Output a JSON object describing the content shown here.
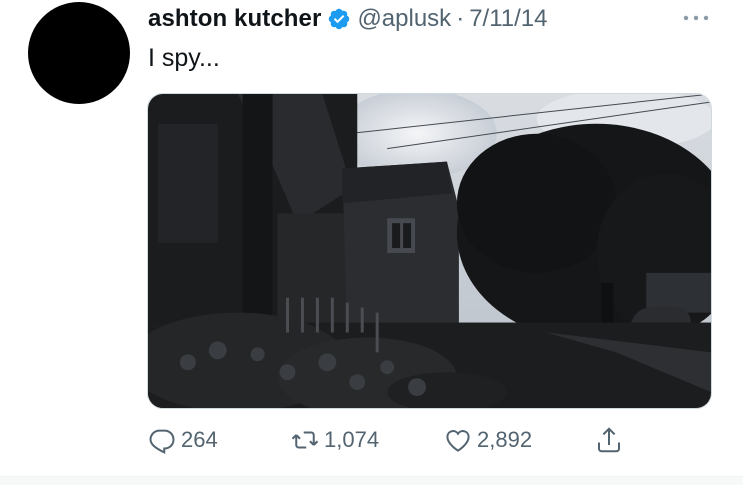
{
  "tweet": {
    "author_name": "ashton kutcher",
    "handle": "@aplusk",
    "separator": "·",
    "date": "7/11/14",
    "text": "I spy...",
    "verified": true
  },
  "actions": {
    "reply_count": "264",
    "retweet_count": "1,074",
    "like_count": "2,892"
  },
  "icons": {
    "avatar": "avatar",
    "verified": "verified-badge-icon",
    "more": "more-dots-icon",
    "reply": "reply-icon",
    "retweet": "retweet-icon",
    "like": "heart-icon",
    "share": "share-icon"
  },
  "colors": {
    "text": "#0f1419",
    "secondary": "#536471",
    "verified_blue": "#1d9bf0"
  }
}
